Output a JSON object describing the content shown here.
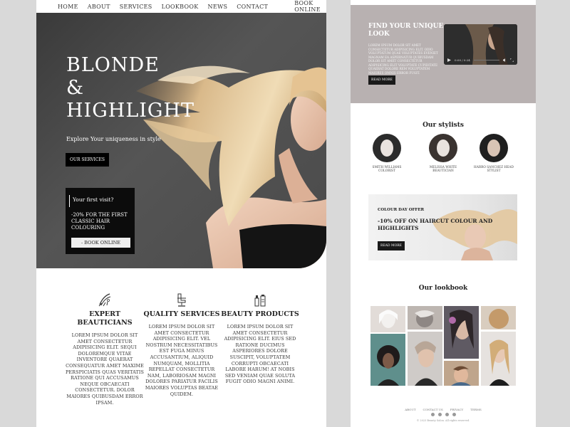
{
  "nav": {
    "items": [
      "HOME",
      "ABOUT",
      "SERVICES",
      "LOOKBOOK",
      "NEWS",
      "CONTACT"
    ],
    "search_icon": "search-icon",
    "cart_icon": "cart-icon",
    "book_online": "BOOK ONLINE"
  },
  "hero": {
    "title": "BLONDE\n&\nHIGHLIGHT",
    "subtitle": "Explore Your uniqueness in style",
    "button": "OUR SERVICES"
  },
  "promo": {
    "heading": "Your first visit?",
    "text": "-20% FOR THE FIRST CLASSIC HAIR COLOURING",
    "button": "- BOOK ONLINE"
  },
  "features": [
    {
      "icon": "hair-brush-icon",
      "title": "EXPERT BEAUTICIANS",
      "text": "LOREM IPSUM DOLOR SIT AMET CONSECTETUR ADIPISICING ELIT. SEQUI DOLOREMQUE VITAE INVENTORE QUAERAT CONSEQUATUR AMET MAXIME PERSPICIATIS QUAS VERITATIS RATIONE QUI ACCUSAMUS NEQUE OBCAECATI CONSECTETUR. DOLOR MAIORES QUIBUSDAM ERROR IPSAM."
    },
    {
      "icon": "salon-chair-icon",
      "title": "QUALITY SERVICES",
      "text": "LOREM IPSUM DOLOR SIT AMET CONSECTETUR ADIPISICING ELIT. VEL NOSTRUM NECESSITATIBUS EST FUGA MINUS ACCUSANTIUM, ALIQUID NUMQUAM, MOLLITIA REPELLAT CONSECTETUR NAM, LABORIOSAM MAGNI DOLORES PARIATUR FACILIS MAIORES VOLUPTAS BEATAE QUIDEM."
    },
    {
      "icon": "beauty-products-icon",
      "title": "BEAUTY PRODUCTS",
      "text": "LOREM IPSUM DOLOR SIT AMET CONSECTETUR ADIPISICING ELIT. EIUS SED RATIONE DUCIMUS ASPERIORES DOLORE SUSCIPIT, VOLUPTATEM CORRUPTI OBCAECATI LABORE HARUM! AT NOBIS SED VENIAM QUAE SOLUTA FUGIT ODIO MAGNI ANIMI."
    }
  ],
  "right": {
    "find_title": "FIND YOUR UNIQUE\nLOOK",
    "find_text": "LOREM IPSUM DOLOR SIT AMET CONSECTETUR ADIPISICING ELIT. ODIO VOLUPTATUM QUAE VOLUPTATES EVENIET MAGNAM EA ASPERNATUR QUIBUSDAM DOLOR SIT AMET CONSECTETUR ADIPISICING ELIT VOLUPTATE CUPIDITATE QUAERAT DOLORE REM VOLUPTATEM MAIORES OMNIS ERROR FUGIT.",
    "find_button": "READ MORE",
    "video_time": "0:00 / 0:24",
    "stylists_title": "Our stylists",
    "stylists": [
      {
        "name": "SMITH WILLIAMS COLORIST"
      },
      {
        "name": "MELISSA WHITE BEAUTICIAN"
      },
      {
        "name": "HARRO SANCHEZ HEAD STYLIST"
      }
    ],
    "offer_label": "COLOUR DAY OFFER",
    "offer_title": "-10% OFF ON HAIRCUT COLOUR AND\nHIGHLIGHTS",
    "offer_button": "READ MORE",
    "lookbook_title": "Our lookbook",
    "footer_links": [
      "ABOUT",
      "CONTACT US",
      "PRIVACY",
      "TERMS"
    ],
    "footer_copy": "© 2023 Beauty Salon. All rights reserved."
  }
}
